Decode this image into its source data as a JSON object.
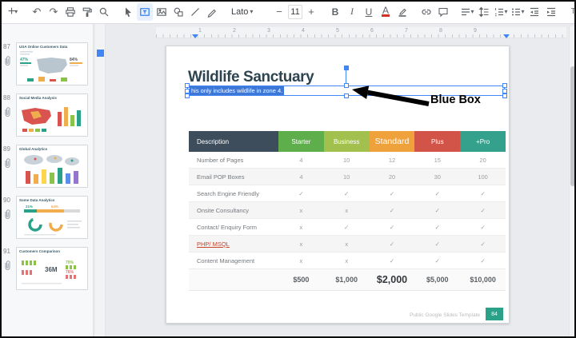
{
  "toolbar": {
    "plus": "+",
    "caret": "▾",
    "undo": "↶",
    "redo": "↷",
    "font_family": "Lato",
    "minus": "−",
    "font_size": "11",
    "size_plus": "+",
    "bold": "B",
    "italic": "I",
    "underline": "U",
    "text_color": "A",
    "clear_formatting": "Tx",
    "more": "⋯",
    "icon_names": [
      "plus",
      "undo",
      "redo",
      "print",
      "paint-format",
      "zoom",
      "select-cursor",
      "text-box",
      "insert-image",
      "insert-shape",
      "insert-line",
      "pen",
      "insert-link",
      "insert-comment",
      "align",
      "line-spacing",
      "numbered-list",
      "bulleted-list",
      "decrease-indent",
      "increase-indent",
      "clear-formatting",
      "more"
    ]
  },
  "sidebar": {
    "slides": [
      {
        "number": "87",
        "title": "USA Online Customers Data",
        "stats": [
          "47%",
          "84%"
        ]
      },
      {
        "number": "88",
        "title": "Social Media Analysis",
        "stats": []
      },
      {
        "number": "89",
        "title": "Global Analytics",
        "stats": []
      },
      {
        "number": "90",
        "title": "Some Data Analytics",
        "stats": [
          "21%",
          "64%"
        ]
      },
      {
        "number": "91",
        "title": "Customers Comparison",
        "stats": [
          "36M",
          "70%",
          "76%"
        ]
      }
    ]
  },
  "ruler": {
    "numbers": [
      "1",
      "2",
      "3",
      "4",
      "5",
      "6",
      "7",
      "8",
      "9"
    ]
  },
  "slide": {
    "title": "Wildlife Sanctuary",
    "textbox_text": "his only includes wildlife in zone 4.",
    "footer": "Public Google Slides Template",
    "page_badge": "84"
  },
  "annotation": {
    "label": "Blue Box"
  },
  "colors": {
    "selection_accent": "#4285f4",
    "text_selection": "#3d78d8",
    "badge": "#2aa189"
  },
  "table": {
    "headers": [
      {
        "label": "Description",
        "color": "#3d4d5c"
      },
      {
        "label": "Starter",
        "color": "#5fae4c"
      },
      {
        "label": "Business",
        "color": "#a2c04d"
      },
      {
        "label": "Standard",
        "color": "#efa23c"
      },
      {
        "label": "Plus",
        "color": "#d25448"
      },
      {
        "label": "+Pro",
        "color": "#33a18c"
      }
    ],
    "rows": [
      {
        "label": "Number of Pages",
        "cells": [
          "4",
          "10",
          "12",
          "15",
          "20"
        ]
      },
      {
        "label": "Email POP Boxes",
        "cells": [
          "4",
          "10",
          "20",
          "30",
          "100"
        ]
      },
      {
        "label": "Search Engine Friendly",
        "cells": [
          "✓",
          "✓",
          "✓",
          "✓",
          "✓"
        ]
      },
      {
        "label": "Onsite Consultancy",
        "cells": [
          "x",
          "x",
          "✓",
          "✓",
          "✓"
        ]
      },
      {
        "label": "Contact/ Enquiry Form",
        "cells": [
          "x",
          "✓",
          "✓",
          "✓",
          "✓"
        ]
      },
      {
        "label": "PHP/ MSQL",
        "cells": [
          "x",
          "x",
          "✓",
          "✓",
          "✓"
        ]
      },
      {
        "label": "Content Management",
        "cells": [
          "x",
          "x",
          "✓",
          "✓",
          "✓"
        ]
      }
    ],
    "price_row": [
      "",
      "$500",
      "$1,000",
      "$2,000",
      "$5,000",
      "$10,000"
    ]
  }
}
